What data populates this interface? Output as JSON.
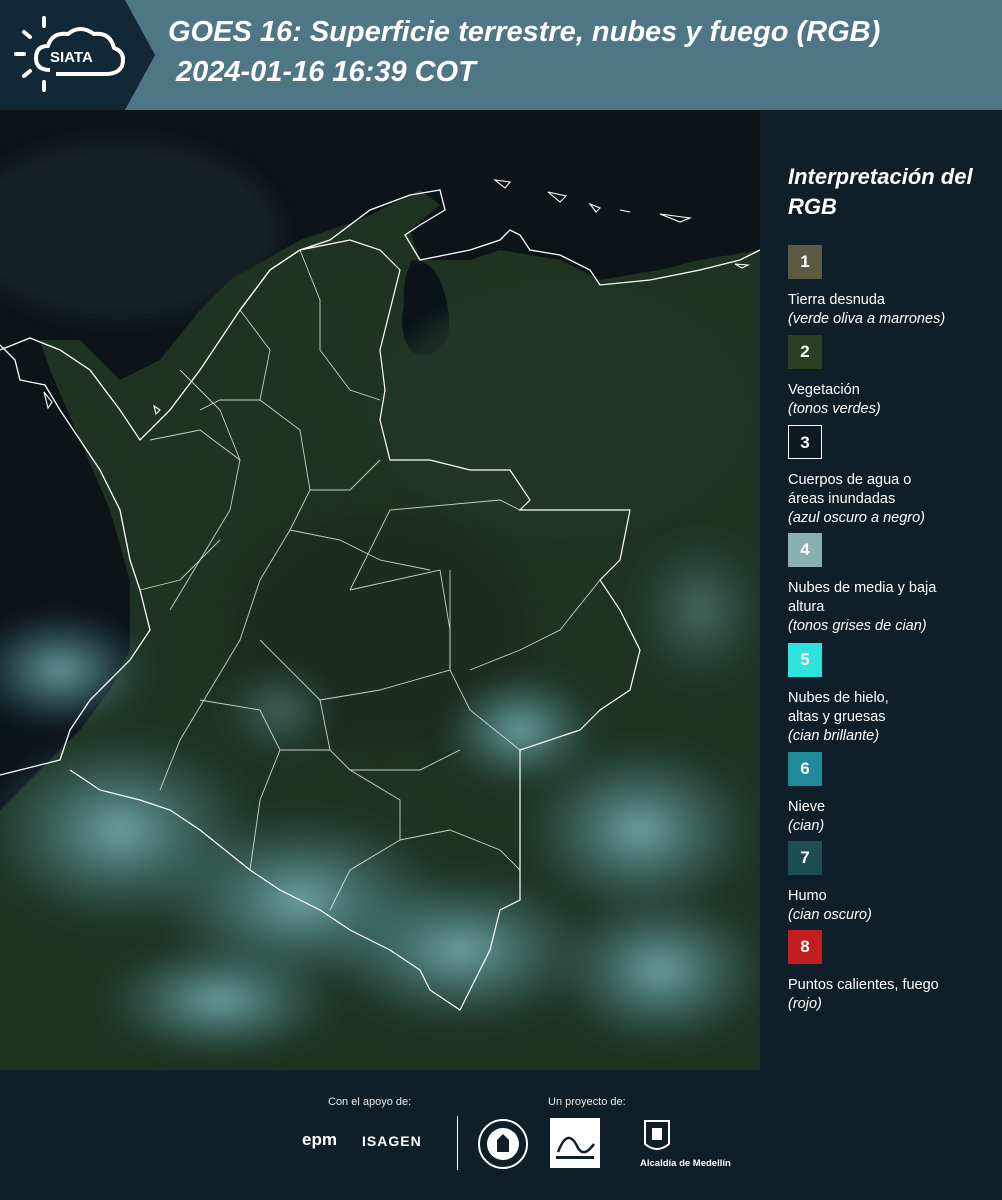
{
  "header": {
    "logo_text": "SIATA",
    "title": "GOES 16: Superficie terrestre, nubes y fuego (RGB)",
    "timestamp": "2024-01-16 16:39 COT"
  },
  "legend": {
    "title": "Interpretación del RGB",
    "items": [
      {
        "number": "1",
        "label": "Tierra desnuda",
        "note": "(verde oliva a marrones)",
        "color": "#5b5b44"
      },
      {
        "number": "2",
        "label": "Vegetación",
        "note": "(tonos verdes)",
        "color": "#2b3f22"
      },
      {
        "number": "3",
        "label": "Cuerpos de agua o áreas inundadas",
        "note": "(azul oscuro a negro)",
        "color": "#0d1a22"
      },
      {
        "number": "4",
        "label": "Nubes de media y baja altura",
        "note": "(tonos grises de cian)",
        "color": "#8ab0b0"
      },
      {
        "number": "5",
        "label": "Nubes de hielo, altas y gruesas",
        "note": "(cian brillante)",
        "color": "#2fe2de"
      },
      {
        "number": "6",
        "label": "Nieve",
        "note": "(cian)",
        "color": "#1e8a9a"
      },
      {
        "number": "7",
        "label": "Humo",
        "note": "(cian oscuro)",
        "color": "#1c4e52"
      },
      {
        "number": "8",
        "label": "Puntos calientes, fuego",
        "note": "(rojo)",
        "color": "#c11f1f"
      }
    ]
  },
  "footer": {
    "support_label": "Con el apoyo de:",
    "project_label": "Un proyecto de:",
    "sponsors": [
      "epm",
      "ISAGEN"
    ],
    "project_partners": [
      "Alcaldía de Medellín"
    ]
  },
  "map": {
    "land_color": "#1f3323",
    "ocean_color": "#0c1418",
    "cloud_color": "#5fa8aa",
    "border_color": "#ffffff"
  }
}
